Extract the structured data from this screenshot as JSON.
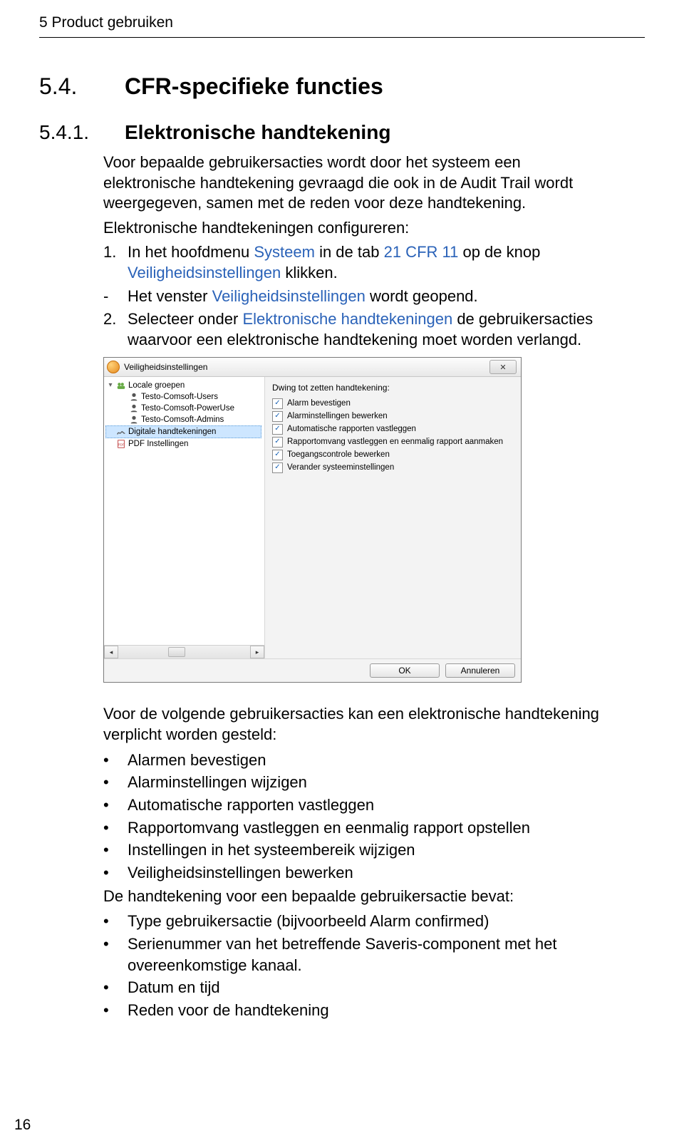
{
  "header": "5 Product gebruiken",
  "page_number": "16",
  "h2": {
    "num": "5.4.",
    "title": "CFR-specifieke functies"
  },
  "h3": {
    "num": "5.4.1.",
    "title": "Elektronische handtekening"
  },
  "intro": "Voor bepaalde gebruikersacties wordt door het systeem een elektronische handtekening gevraagd die ook in de Audit Trail wordt weergegeven, samen met de reden voor deze handtekening.",
  "intro2": "Elektronische handtekeningen configureren:",
  "step1": {
    "marker": "1.",
    "a": "In het hoofdmenu ",
    "hl1": "Systeem",
    "b": " in de tab ",
    "hl2": "21 CFR 11",
    "c": " op de knop ",
    "hl3": "Veiligheidsinstellingen",
    "d": " klikken."
  },
  "step1sub": {
    "marker": "-",
    "a": "Het venster ",
    "hl": "Veiligheidsinstellingen",
    "b": " wordt geopend."
  },
  "step2": {
    "marker": "2.",
    "a": "Selecteer onder ",
    "hl": "Elektronische handtekeningen",
    "b": " de gebruikersacties waarvoor een elektronische handtekening moet worden verlangd."
  },
  "dialog": {
    "title": "Veiligheidsinstellingen",
    "close": "✕",
    "tree": {
      "root": "Locale groepen",
      "items": [
        "Testo-Comsoft-Users",
        "Testo-Comsoft-PowerUse",
        "Testo-Comsoft-Admins"
      ],
      "digital": "Digitale handtekeningen",
      "pdf": "PDF Instellingen"
    },
    "right_label": "Dwing tot zetten handtekening:",
    "checks": [
      "Alarm bevestigen",
      "Alarminstellingen bewerken",
      "Automatische rapporten vastleggen",
      "Rapportomvang vastleggen en eenmalig rapport aanmaken",
      "Toegangscontrole bewerken",
      "Verander systeeminstellingen"
    ],
    "ok": "OK",
    "cancel": "Annuleren"
  },
  "after_intro": "Voor de volgende gebruikersacties kan een elektronische handtekening verplicht worden gesteld:",
  "bullets1": [
    "Alarmen bevestigen",
    "Alarminstellingen wijzigen",
    "Automatische rapporten vastleggen",
    "Rapportomvang vastleggen en eenmalig rapport opstellen",
    "Instellingen in het systeembereik wijzigen",
    "Veiligheidsinstellingen bewerken"
  ],
  "after2": "De handtekening voor een bepaalde gebruikersactie bevat:",
  "bullets2": [
    "Type gebruikersactie (bijvoorbeeld Alarm confirmed)",
    "Serienummer van het betreffende Saveris-component met het overeenkomstige kanaal.",
    "Datum en tijd",
    "Reden voor de handtekening"
  ]
}
